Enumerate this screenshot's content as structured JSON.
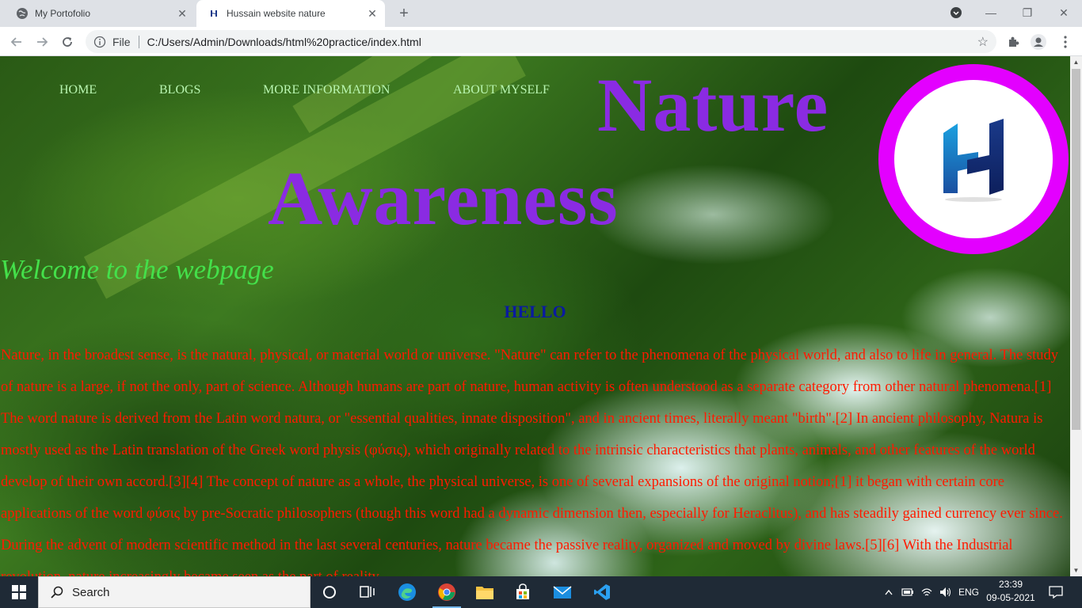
{
  "browser": {
    "tabs": [
      {
        "title": "My Portofolio",
        "active": false
      },
      {
        "title": "Hussain website nature",
        "active": true
      }
    ],
    "address": {
      "scheme_label": "File",
      "url": "C:/Users/Admin/Downloads/html%20practice/index.html"
    }
  },
  "page": {
    "nav": [
      "HOME",
      "BLOGS",
      "MORE INFORMATION",
      "ABOUT MYSELF"
    ],
    "title_line1": "Nature",
    "title_line2": "Awareness",
    "welcome": "Welcome to the webpage",
    "hello": "HELLO",
    "paragraph": "Nature, in the broadest sense, is the natural, physical, or material world or universe. \"Nature\" can refer to the phenomena of the physical world, and also to life in general. The study of nature is a large, if not the only, part of science. Although humans are part of nature, human activity is often understood as a separate category from other natural phenomena.[1] The word nature is derived from the Latin word natura, or \"essential qualities, innate disposition\", and in ancient times, literally meant \"birth\".[2] In ancient philosophy, Natura is mostly used as the Latin translation of the Greek word physis (φύσις), which originally related to the intrinsic characteristics that plants, animals, and other features of the world develop of their own accord.[3][4] The concept of nature as a whole, the physical universe, is one of several expansions of the original notion;[1] it began with certain core applications of the word φύσις by pre-Socratic philosophers (though this word had a dynamic dimension then, especially for Heraclitus), and has steadily gained currency ever since. During the advent of modern scientific method in the last several centuries, nature became the passive reality, organized and moved by divine laws.[5][6] With the Industrial revolution, nature increasingly became seen as the part of reality",
    "colors": {
      "title": "#8a2be2",
      "nav": "#b8f5b0",
      "welcome": "#44e04a",
      "hello": "#0a1aa0",
      "paragraph": "#ff1a00",
      "logo_ring": "#e300ff"
    }
  },
  "taskbar": {
    "search_label": "Search",
    "pinned": [
      "task-view-icon",
      "edge-icon",
      "chrome-icon",
      "file-explorer-icon",
      "store-icon",
      "mail-icon",
      "vscode-icon"
    ],
    "language": "ENG",
    "time": "23:39",
    "date": "09-05-2021"
  }
}
